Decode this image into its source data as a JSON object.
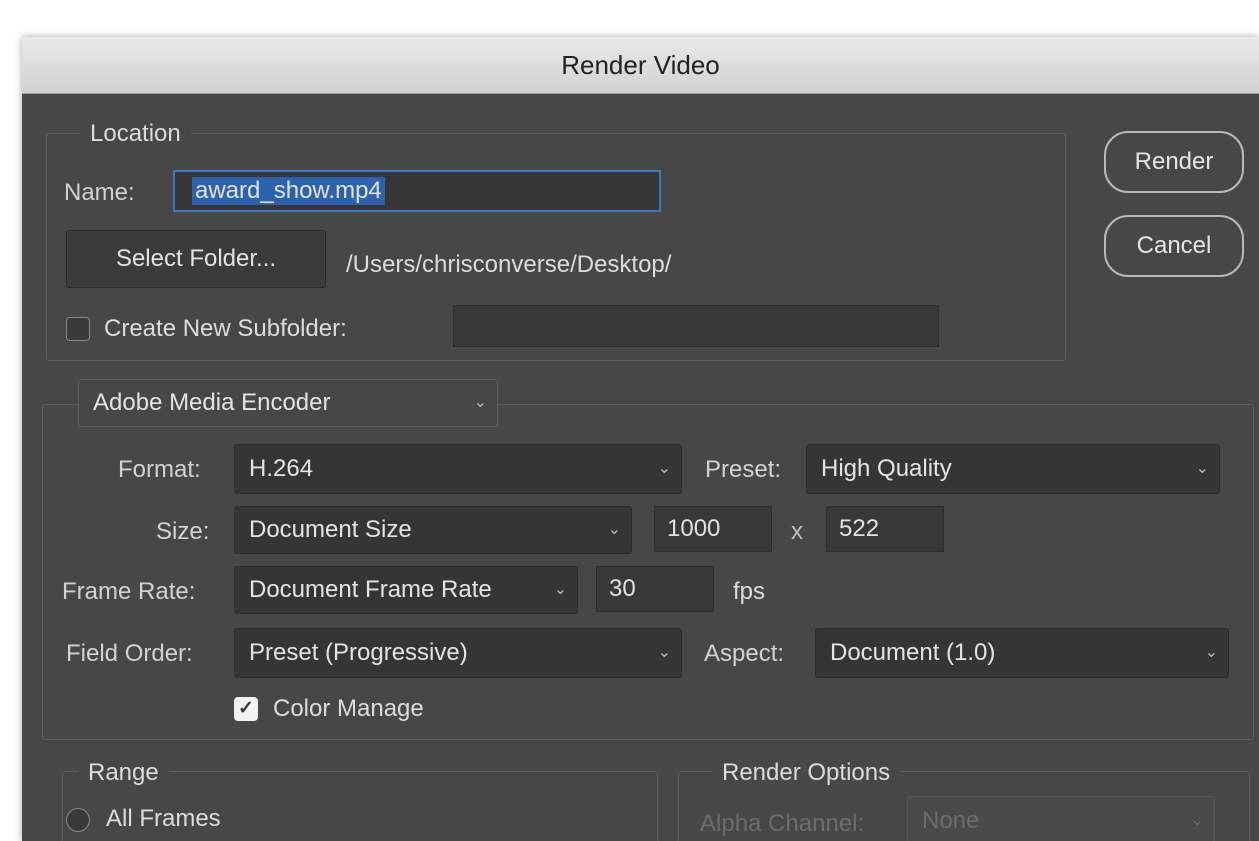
{
  "window": {
    "title": "Render Video"
  },
  "location": {
    "legend": "Location",
    "name_label": "Name:",
    "name_value": "award_show.mp4",
    "select_folder_label": "Select Folder...",
    "folder_path": "/Users/chrisconverse/Desktop/",
    "create_subfolder_label": "Create New Subfolder:",
    "create_subfolder_checked": false,
    "subfolder_value": ""
  },
  "actions": {
    "render_label": "Render",
    "cancel_label": "Cancel"
  },
  "encoder": {
    "selected": "Adobe Media Encoder",
    "format_label": "Format:",
    "format_value": "H.264",
    "preset_label": "Preset:",
    "preset_value": "High Quality",
    "size_label": "Size:",
    "size_value": "Document Size",
    "width_value": "1000",
    "times_symbol": "x",
    "height_value": "522",
    "frame_rate_label": "Frame Rate:",
    "frame_rate_value": "Document Frame Rate",
    "fps_value": "30",
    "fps_unit": "fps",
    "field_order_label": "Field Order:",
    "field_order_value": "Preset (Progressive)",
    "aspect_label": "Aspect:",
    "aspect_value": "Document (1.0)",
    "color_manage_label": "Color Manage",
    "color_manage_checked": true
  },
  "range": {
    "legend": "Range",
    "all_frames_label": "All Frames"
  },
  "render_options": {
    "legend": "Render Options",
    "alpha_channel_label": "Alpha Channel:",
    "alpha_channel_value": "None"
  },
  "colors": {
    "dialog_bg": "#474747",
    "selection": "#2d62ae",
    "focus_ring": "#3b78c9"
  },
  "icons": {
    "dropdown": "chevron-down-icon",
    "check": "checkmark-icon"
  }
}
